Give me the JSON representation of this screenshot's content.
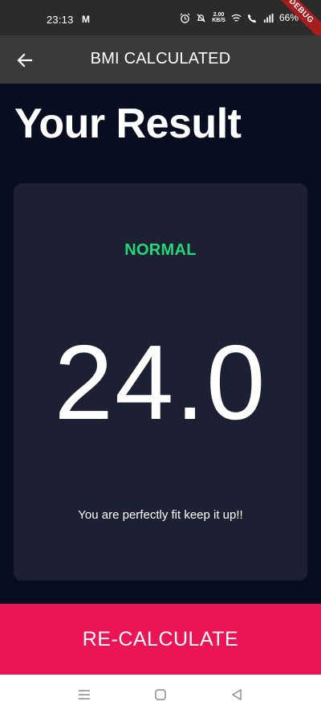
{
  "status_bar": {
    "time": "23:13",
    "carrier_glyph": "M",
    "speed_top": "2.00",
    "speed_bottom": "KB/S",
    "battery": "66%",
    "debug": "DEBUG"
  },
  "app_bar": {
    "title": "BMI CALCULATED",
    "back_icon": "arrow-back-icon"
  },
  "main": {
    "title": "Your Result",
    "card": {
      "status": "NORMAL",
      "status_color": "#24d876",
      "bmi_value": "24.0",
      "message": "You are perfectly fit keep it up!!"
    }
  },
  "bottom_button": {
    "label": "RE-CALCULATE",
    "color": "#eb1555"
  },
  "nav_bar": {
    "items": [
      "menu-icon",
      "home-square-icon",
      "back-triangle-icon"
    ]
  }
}
